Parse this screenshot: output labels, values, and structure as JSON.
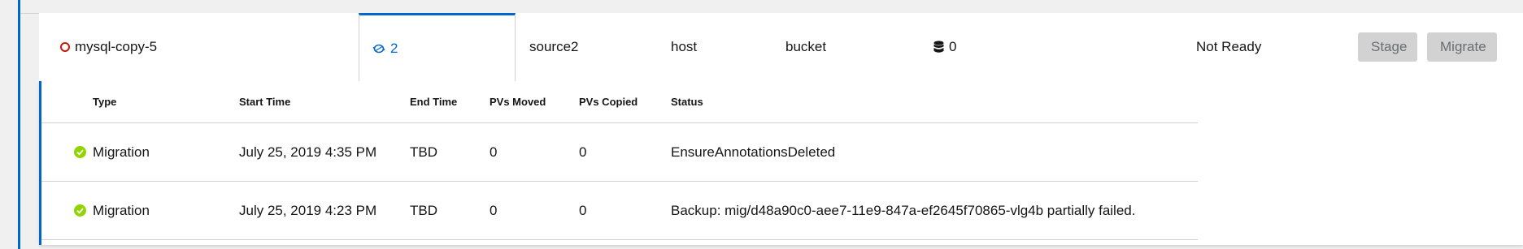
{
  "plan": {
    "name": "mysql-copy-5",
    "migrations_count": "2",
    "source_cluster": "source2",
    "target_cluster": "host",
    "repository": "bucket",
    "pv_count": "0",
    "status": "Not Ready",
    "stage_label": "Stage",
    "migrate_label": "Migrate"
  },
  "migrations_table": {
    "headers": {
      "type": "Type",
      "start_time": "Start Time",
      "end_time": "End Time",
      "pvs_moved": "PVs Moved",
      "pvs_copied": "PVs Copied",
      "status": "Status"
    },
    "rows": [
      {
        "type": "Migration",
        "start_time": "July 25, 2019 4:35 PM",
        "end_time": "TBD",
        "pvs_moved": "0",
        "pvs_copied": "0",
        "status": "EnsureAnnotationsDeleted"
      },
      {
        "type": "Migration",
        "start_time": "July 25, 2019 4:23 PM",
        "end_time": "TBD",
        "pvs_moved": "0",
        "pvs_copied": "0",
        "status": "Backup: mig/d48a90c0-aee7-11e9-847a-ef2645f70865-vlg4b partially failed."
      }
    ]
  },
  "colors": {
    "accent": "#0066cc",
    "not_ready": "#c9190b",
    "success": "#92d400",
    "disabled_button": "#d2d2d2"
  },
  "icons": {
    "plan_status": "not-ready-circle-icon",
    "migrations": "migration-sync-icon",
    "volumes": "database-icon",
    "row_status": "check-circle-icon"
  }
}
